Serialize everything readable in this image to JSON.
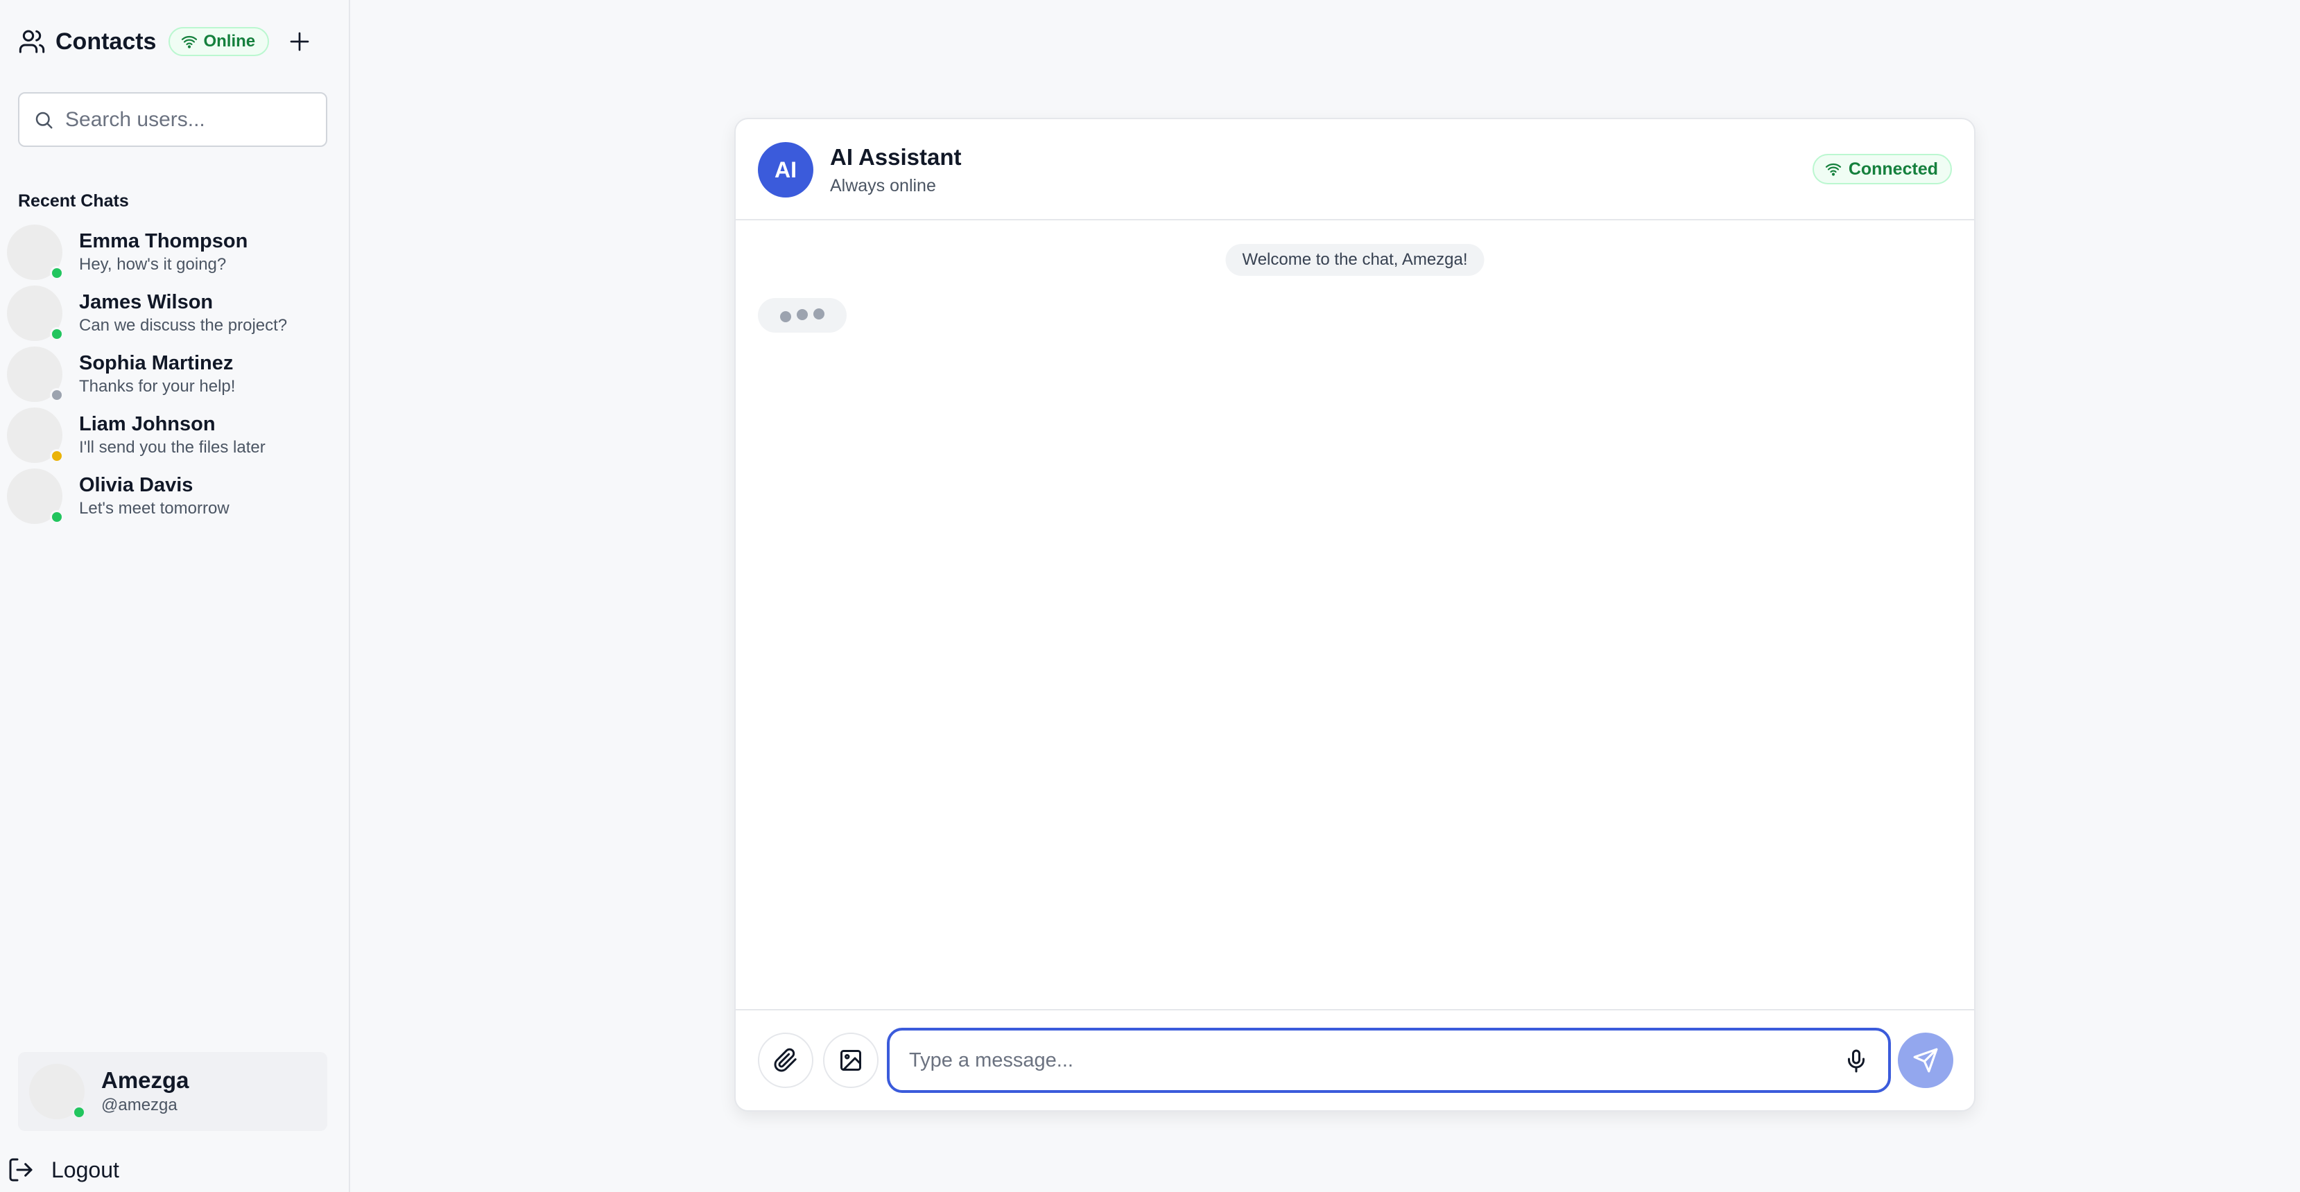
{
  "sidebar": {
    "title": "Contacts",
    "status_badge": "Online",
    "search_placeholder": "Search users...",
    "section_label": "Recent Chats",
    "chats": [
      {
        "name": "Emma Thompson",
        "message": "Hey, how's it going?",
        "status": "online",
        "status_color": "#22c55e"
      },
      {
        "name": "James Wilson",
        "message": "Can we discuss the project?",
        "status": "online",
        "status_color": "#22c55e"
      },
      {
        "name": "Sophia Martinez",
        "message": "Thanks for your help!",
        "status": "offline",
        "status_color": "#9ca3af"
      },
      {
        "name": "Liam Johnson",
        "message": "I'll send you the files later",
        "status": "away",
        "status_color": "#eab308"
      },
      {
        "name": "Olivia Davis",
        "message": "Let's meet tomorrow",
        "status": "online",
        "status_color": "#22c55e"
      }
    ],
    "current_user": {
      "name": "Amezga",
      "handle": "@amezga",
      "status_color": "#22c55e"
    },
    "logout_label": "Logout"
  },
  "chat": {
    "avatar_initials": "AI",
    "name": "AI Assistant",
    "subtitle": "Always online",
    "connection_badge": "Connected",
    "welcome_message": "Welcome to the chat, Amezga!",
    "input_placeholder": "Type a message..."
  },
  "colors": {
    "accent": "#3b5bdb",
    "send_button": "#93a7ee",
    "online_green": "#22c55e",
    "badge_text": "#15803d"
  },
  "icons": {
    "contacts": "users-icon",
    "wifi": "wifi-icon",
    "add": "plus-icon",
    "search": "search-icon",
    "logout": "logout-icon",
    "attach": "paperclip-icon",
    "image": "image-icon",
    "mic": "microphone-icon",
    "send": "send-icon"
  }
}
